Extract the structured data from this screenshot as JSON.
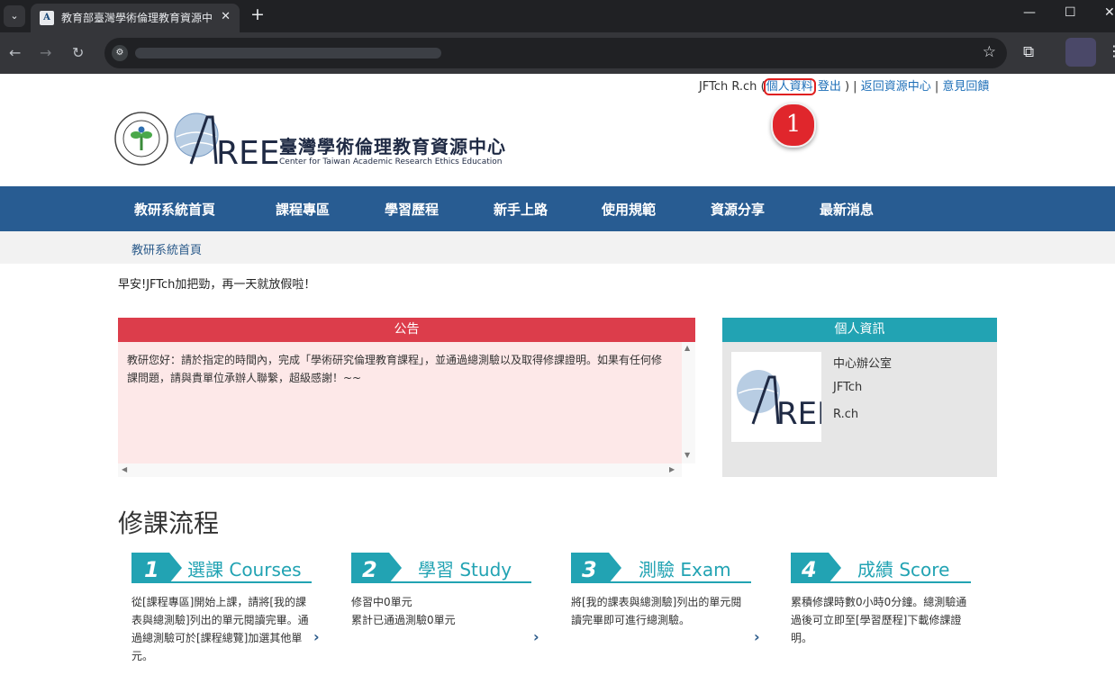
{
  "browser": {
    "tab_title": "教育部臺灣學術倫理教育資源中",
    "tab_favicon": "A",
    "icons": [
      "tab-search-icon",
      "close-icon",
      "new-tab-icon",
      "minimize-icon",
      "maximize-icon",
      "window-close-icon",
      "back-icon",
      "forward-icon",
      "reload-icon",
      "site-info-icon",
      "bookmark-star-icon",
      "extensions-icon",
      "menu-icon"
    ]
  },
  "top_links": {
    "user": "JFTch R.ch",
    "open_paren": "(",
    "profile": "個人資料",
    "logout": "登出",
    "close_paren": ") |",
    "back": "返回資源中心",
    "sep": "|",
    "feedback": "意見回饋"
  },
  "marker": "1",
  "header": {
    "title": "臺灣學術倫理教育資源中心",
    "subtitle": "Center for Taiwan Academic Research Ethics Education",
    "logo_text": "AREE"
  },
  "nav": [
    {
      "label": "教研系統首頁"
    },
    {
      "label": "課程專區"
    },
    {
      "label": "學習歷程"
    },
    {
      "label": "新手上路"
    },
    {
      "label": "使用規範"
    },
    {
      "label": "資源分享"
    },
    {
      "label": "最新消息"
    }
  ],
  "breadcrumb": "教研系統首頁",
  "greeting": "早安!JFTch加把勁，再一天就放假啦！",
  "announcement": {
    "title": "公告",
    "body": "教研您好：請於指定的時間內，完成「學術研究倫理教育課程」，並通過總測驗以及取得修課證明。如果有任何修課問題，請與貴單位承辦人聯繫，超級感謝！~~"
  },
  "profile_card": {
    "title": "個人資訊",
    "logo_text": "AREE",
    "lines": [
      "中心辦公室",
      "JFTch",
      "R.ch"
    ]
  },
  "flow": {
    "title": "修課流程",
    "steps": [
      {
        "num": "1",
        "label": "選課 Courses",
        "desc": "從[課程專區]開始上課，請將[我的課表與總測驗]列出的單元閱讀完畢。通過總測驗可於[課程總覽]加選其他單元。"
      },
      {
        "num": "2",
        "label": "學習 Study",
        "desc_1": "修習中0單元",
        "desc_2": "累計已通過測驗0單元"
      },
      {
        "num": "3",
        "label": "測驗 Exam",
        "desc": "將[我的課表與總測驗]列出的單元閱讀完畢即可進行總測驗。"
      },
      {
        "num": "4",
        "label": "成績 Score",
        "desc": "累積修課時數0小時0分鐘。總測驗通過後可立即至[學習歷程]下載修課證明。"
      }
    ]
  },
  "colors": {
    "nav_bg": "#285c92",
    "announcement_head": "#dc3d4b",
    "info_head": "#22a3b3",
    "marker": "#e0262c"
  }
}
